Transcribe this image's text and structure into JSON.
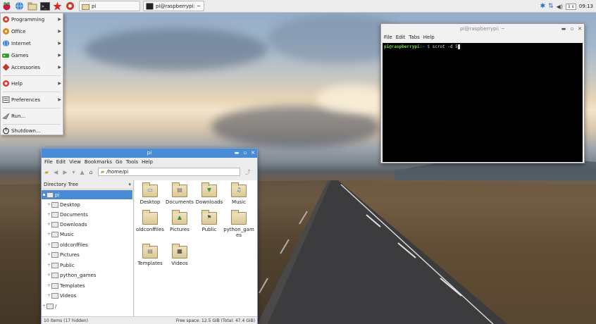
{
  "panel": {
    "launchers": [
      "raspberry-menu-icon",
      "web-browser-icon",
      "file-manager-icon",
      "terminal-icon",
      "mathematica-icon",
      "wolfram-icon"
    ],
    "tasks": [
      {
        "label": "pi",
        "icon": "folder-icon"
      },
      {
        "label": "pi@raspberrypi: ~",
        "icon": "terminal-icon"
      }
    ],
    "tray": {
      "volume_badge": "1 s",
      "clock": "09:13"
    }
  },
  "menu": {
    "items": [
      {
        "label": "Programming",
        "icon": "programming-icon",
        "submenu": true
      },
      {
        "label": "Office",
        "icon": "office-icon",
        "submenu": true
      },
      {
        "label": "Internet",
        "icon": "internet-icon",
        "submenu": true
      },
      {
        "label": "Games",
        "icon": "games-icon",
        "submenu": true
      },
      {
        "label": "Accessories",
        "icon": "accessories-icon",
        "submenu": true
      },
      {
        "label": "Help",
        "icon": "help-icon",
        "submenu": true
      },
      {
        "label": "Preferences",
        "icon": "preferences-icon",
        "submenu": true
      },
      {
        "label": "Run...",
        "icon": "run-icon",
        "submenu": false
      },
      {
        "label": "Shutdown...",
        "icon": "shutdown-icon",
        "submenu": false
      }
    ]
  },
  "terminal": {
    "title": "pi@raspberrypi: ~",
    "menu": [
      "File",
      "Edit",
      "Tabs",
      "Help"
    ],
    "prompt_user": "pi@raspberrypi",
    "prompt_rest": ":~ $",
    "command": "scrot -d 5"
  },
  "filemanager": {
    "title": "pi",
    "menu": [
      "File",
      "Edit",
      "View",
      "Bookmarks",
      "Go",
      "Tools",
      "Help"
    ],
    "path": "/home/pi",
    "tree_header": "Directory Tree",
    "tree": [
      {
        "label": "pi",
        "selected": true
      },
      {
        "label": "Desktop"
      },
      {
        "label": "Documents"
      },
      {
        "label": "Downloads"
      },
      {
        "label": "Music"
      },
      {
        "label": "oldconffiles"
      },
      {
        "label": "Pictures"
      },
      {
        "label": "Public"
      },
      {
        "label": "python_games"
      },
      {
        "label": "Templates"
      },
      {
        "label": "Videos"
      },
      {
        "label": "/"
      }
    ],
    "icons": [
      {
        "label": "Desktop",
        "symbol": "▭",
        "color": "#4a7fc1"
      },
      {
        "label": "Documents",
        "symbol": "▤",
        "color": "#6b6b6b"
      },
      {
        "label": "Downloads",
        "symbol": "▼",
        "color": "#3a9a35"
      },
      {
        "label": "Music",
        "symbol": "♫",
        "color": "#3a6fb0"
      },
      {
        "label": "oldconffiles",
        "symbol": "",
        "color": "#000000"
      },
      {
        "label": "Pictures",
        "symbol": "▲",
        "color": "#3a8a3a"
      },
      {
        "label": "Public",
        "symbol": "⚑",
        "color": "#555555"
      },
      {
        "label": "python_games",
        "symbol": "",
        "color": "#000000"
      },
      {
        "label": "Templates",
        "symbol": "▤",
        "color": "#777777"
      },
      {
        "label": "Videos",
        "symbol": "▦",
        "color": "#333333"
      }
    ],
    "status_left": "10 items (17 hidden)",
    "status_right": "Free space: 12.5 GiB (Total: 47.4 GiB)"
  }
}
